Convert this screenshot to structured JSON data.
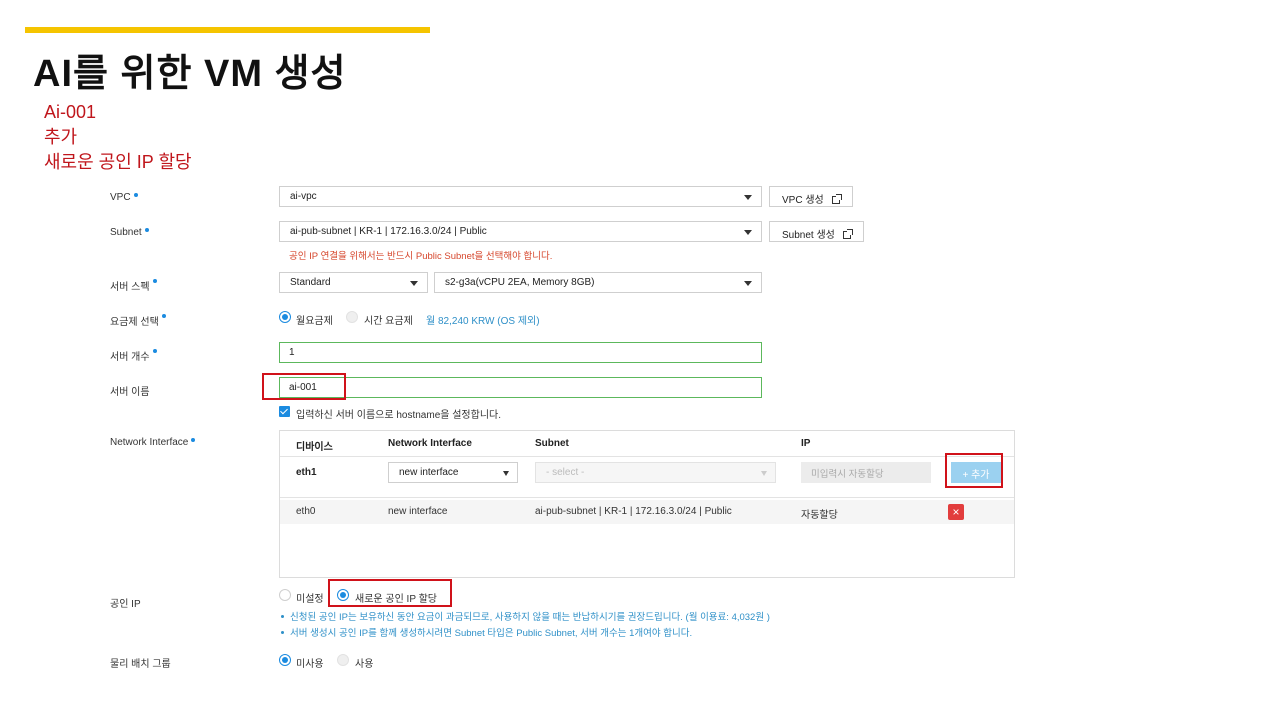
{
  "slide": {
    "title": "AI를 위한 VM 생성",
    "notes": [
      "Ai-001",
      "추가",
      "새로운 공인 IP 할당"
    ]
  },
  "form": {
    "vpc": {
      "label": "VPC",
      "value": "ai-vpc",
      "button": "VPC 생성"
    },
    "subnet": {
      "label": "Subnet",
      "value": "ai-pub-subnet | KR-1 | 172.16.3.0/24 | Public",
      "button": "Subnet 생성",
      "hint": "공인 IP 연결을 위해서는 반드시 Public Subnet을 선택해야 합니다."
    },
    "server_spec": {
      "label": "서버 스펙",
      "type": "Standard",
      "spec": "s2-g3a(vCPU 2EA, Memory 8GB)"
    },
    "billing": {
      "label": "요금제 선택",
      "option_monthly": "월요금제",
      "option_hourly": "시간 요금제",
      "price": "월 82,240 KRW (OS 제외)",
      "selected": "월요금제"
    },
    "server_count": {
      "label": "서버 개수",
      "value": "1"
    },
    "server_name": {
      "label": "서버 이름",
      "value": "ai-001",
      "hostname_checkbox": "입력하신 서버 이름으로 hostname을 설정합니다."
    },
    "network_interface": {
      "label": "Network Interface",
      "columns": [
        "디바이스",
        "Network Interface",
        "Subnet",
        "IP"
      ],
      "new_row": {
        "device": "eth1",
        "interface": "new interface",
        "subnet_placeholder": "- select -",
        "ip_placeholder": "미입력시 자동할당",
        "add_button": "+ 추가"
      },
      "rows": [
        {
          "device": "eth0",
          "interface": "new interface",
          "subnet": "ai-pub-subnet | KR-1 | 172.16.3.0/24 | Public",
          "ip": "자동할당",
          "delete": "×"
        }
      ]
    },
    "public_ip": {
      "label": "공인 IP",
      "option_none": "미설정",
      "option_new": "새로운 공인 IP 할당",
      "selected": "새로운 공인 IP 할당",
      "notes": [
        "신청된 공인 IP는 보유하신 동안 요금이 과금되므로, 사용하지 않을 때는 반납하시기를 권장드립니다. (월 이용료: 4,032원 )",
        "서버 생성시 공인 IP를 함께 생성하시려면 Subnet 타입은 Public Subnet, 서버 개수는 1개여야 합니다."
      ]
    },
    "placement_group": {
      "label": "물리 배치 그룹",
      "option_unused": "미사용",
      "option_used": "사용",
      "selected": "미사용"
    }
  },
  "colors": {
    "accent_bar": "#f5c400",
    "highlight": "#d0121a",
    "primary_blue": "#1b8be0",
    "note_red": "#c0161c"
  }
}
